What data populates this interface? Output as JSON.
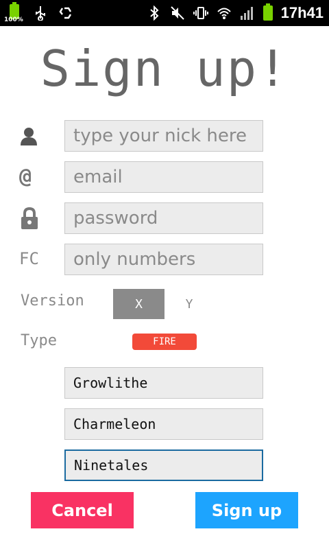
{
  "status_bar": {
    "battery_percent": "100%",
    "time": "17h41",
    "icons": [
      "battery-icon",
      "usb-icon",
      "recycle-icon",
      "bluetooth-icon",
      "mute-icon",
      "vibrate-icon",
      "wifi-icon",
      "signal-icon",
      "battery-icon"
    ],
    "battery_color": "#79d200"
  },
  "title": "Sign up!",
  "form": {
    "nick_placeholder": "type your nick here",
    "email_icon": "@",
    "email_placeholder": "email",
    "password_placeholder": "password",
    "fc_label": "FC",
    "fc_placeholder": "only numbers",
    "version_label": "Version",
    "version_options": [
      "X",
      "Y"
    ],
    "version_selected": "X",
    "type_label": "Type",
    "type_value": "FIRE",
    "type_color": "#f24a39",
    "pokemon": [
      "Growlithe",
      "Charmeleon",
      "Ninetales"
    ]
  },
  "buttons": {
    "cancel": "Cancel",
    "signup": "Sign up",
    "cancel_color": "#f93263",
    "signup_color": "#1da4fe"
  }
}
